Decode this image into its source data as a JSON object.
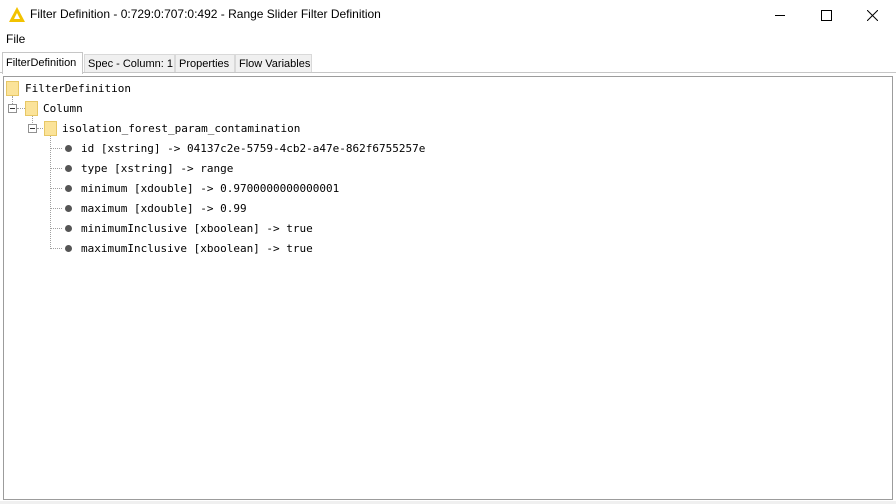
{
  "window": {
    "title": "Filter Definition - 0:729:0:707:0:492 - Range Slider Filter Definition",
    "icon": "knime-triangle-icon",
    "accent_color": "#f2c200"
  },
  "menu": {
    "file_label": "File"
  },
  "tabs": [
    {
      "label": "FilterDefinition",
      "active": true
    },
    {
      "label": "Spec - Column: 1",
      "active": false
    },
    {
      "label": "Properties",
      "active": false
    },
    {
      "label": "Flow Variables",
      "active": false
    }
  ],
  "tree": {
    "root": "FilterDefinition",
    "column": "Column",
    "param": "isolation_forest_param_contamination",
    "leaves": [
      "id [xstring] -> 04137c2e-5759-4cb2-a47e-862f6755257e",
      "type [xstring] -> range",
      "minimum [xdouble] -> 0.9700000000000001",
      "maximum [xdouble] -> 0.99",
      "minimumInclusive [xboolean] -> true",
      "maximumInclusive [xboolean] -> true"
    ]
  }
}
